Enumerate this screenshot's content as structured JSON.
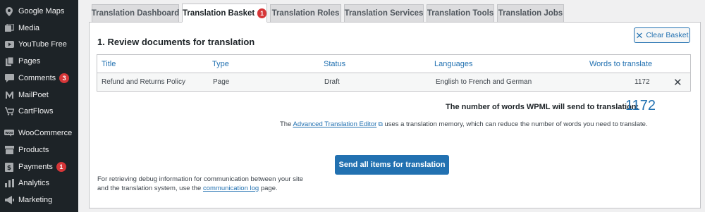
{
  "sidebar": {
    "items": [
      {
        "label": "Google Maps",
        "icon": "map-pin-icon"
      },
      {
        "label": "Media",
        "icon": "media-icon"
      },
      {
        "label": "YouTube Free",
        "icon": "youtube-icon"
      },
      {
        "label": "Pages",
        "icon": "pages-icon"
      },
      {
        "label": "Comments",
        "icon": "comments-icon",
        "badge": "3"
      },
      {
        "label": "MailPoet",
        "icon": "mailpoet-icon"
      },
      {
        "label": "CartFlows",
        "icon": "cartflows-icon"
      },
      {
        "label": "WooCommerce",
        "icon": "woocommerce-icon"
      },
      {
        "label": "Products",
        "icon": "products-icon"
      },
      {
        "label": "Payments",
        "icon": "payments-icon",
        "badge": "1"
      },
      {
        "label": "Analytics",
        "icon": "analytics-icon"
      },
      {
        "label": "Marketing",
        "icon": "marketing-icon"
      }
    ]
  },
  "tabs": [
    {
      "label": "Translation Dashboard"
    },
    {
      "label": "Translation Basket",
      "badge": "1",
      "active": true
    },
    {
      "label": "Translation Roles"
    },
    {
      "label": "Translation Services"
    },
    {
      "label": "Translation Tools"
    },
    {
      "label": "Translation Jobs"
    }
  ],
  "panel": {
    "clear_basket_label": "Clear Basket",
    "section_title": "1. Review documents for translation",
    "table": {
      "headers": [
        "Title",
        "Type",
        "Status",
        "Languages",
        "Words to translate"
      ],
      "rows": [
        {
          "title": "Refund and Returns Policy",
          "type": "Page",
          "status": "Draft",
          "languages": "English to French and German",
          "words": "1172"
        }
      ]
    },
    "total_label": "The number of words WPML will send to translation:",
    "total_value": "1172",
    "ate_prefix": "The",
    "ate_link": "Advanced Translation Editor",
    "ate_suffix": "uses a translation memory, which can reduce the number of words you need to translate.",
    "send_label": "Send all items for translation",
    "debug_prefix": "For retrieving debug information for communication between your site and the translation system, use the",
    "debug_link": "communication log",
    "debug_suffix": "page."
  },
  "colors": {
    "sidebar_bg": "#1d2327",
    "accent": "#2271b1",
    "badge": "#d63638",
    "delete": "#b32d2e"
  }
}
